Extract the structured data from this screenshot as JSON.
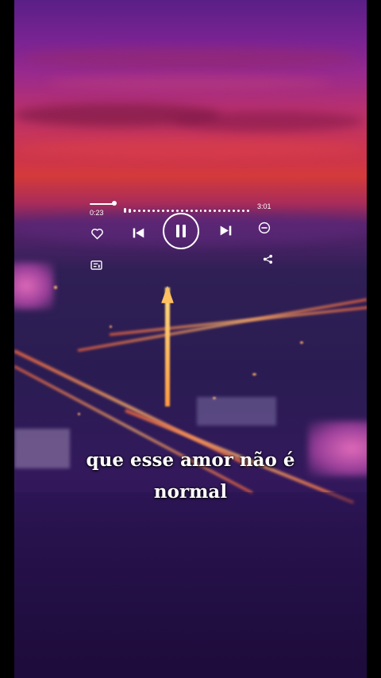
{
  "player": {
    "elapsed": "0:23",
    "duration": "3:01",
    "progress": 0.13,
    "icons": {
      "like": "heart-icon",
      "previous": "skip-previous-icon",
      "play_pause": "pause-icon",
      "next": "skip-next-icon",
      "remove": "minus-circle-icon",
      "lyrics": "lyrics-icon",
      "share": "share-icon"
    }
  },
  "subtitle": {
    "line1": "que esse amor não é",
    "line2": "normal"
  },
  "colors": {
    "sky_top": "#5a1f86",
    "sky_red": "#d43a3a",
    "night": "#2a1c52",
    "foreground": "#ffffff"
  }
}
